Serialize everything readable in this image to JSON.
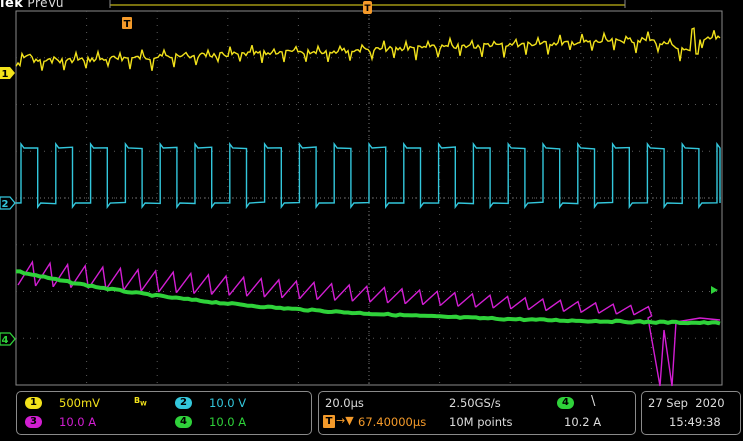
{
  "brand": {
    "name": "lek",
    "mode": "PreVu"
  },
  "colors": {
    "ch1": "#f2e21b",
    "ch2": "#33c7dc",
    "ch3": "#d21ed2",
    "ch4": "#2fd23a",
    "trigger": "#f49a2a",
    "grid": "#5a5a5a",
    "border": "#8a8a8a"
  },
  "markers": {
    "trigger_position": "T",
    "ch1": "1",
    "ch2": "2",
    "ch4": "4"
  },
  "channels": [
    {
      "id": "1",
      "scale": "500mV"
    },
    {
      "id": "2",
      "scale": "10.0 V"
    },
    {
      "id": "3",
      "scale": "10.0 A"
    },
    {
      "id": "4",
      "scale": "10.0 A"
    }
  ],
  "bandwidth_icon": "bandwidth-limit-icon",
  "timebase": {
    "scale": "20.0µs",
    "sample_rate": "2.50GS/s",
    "trigger_delay": "67.40000µs",
    "record_length": "10M points"
  },
  "trigger": {
    "source": "4",
    "slope_icon": "falling-edge-icon",
    "level": "10.2 A"
  },
  "datetime": {
    "date": "27 Sep  2020",
    "time": "15:49:38"
  }
}
